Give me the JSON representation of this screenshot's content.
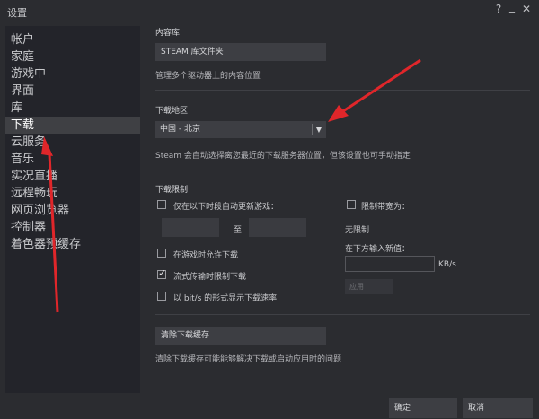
{
  "window": {
    "title": "设置",
    "help": "?",
    "minimize": "_",
    "close": "✕"
  },
  "sidebar": {
    "items": [
      {
        "label": "帐户"
      },
      {
        "label": "家庭"
      },
      {
        "label": "游戏中"
      },
      {
        "label": "界面"
      },
      {
        "label": "库"
      },
      {
        "label": "下载"
      },
      {
        "label": "云服务"
      },
      {
        "label": "音乐"
      },
      {
        "label": "实况直播"
      },
      {
        "label": "远程畅玩"
      },
      {
        "label": "网页浏览器"
      },
      {
        "label": "控制器"
      },
      {
        "label": "着色器预缓存"
      }
    ],
    "active_index": 5
  },
  "content_library": {
    "heading": "内容库",
    "button": "STEAM 库文件夹",
    "description": "管理多个驱动器上的内容位置"
  },
  "download_region": {
    "heading": "下载地区",
    "selected": "中国 - 北京",
    "description": "Steam 会自动选择离您最近的下载服务器位置，但该设置也可手动指定"
  },
  "download_limits": {
    "heading": "下载限制",
    "schedule_label": "仅在以下时段自动更新游戏：",
    "to_label": "至",
    "allow_in_game_label": "在游戏时允许下载",
    "throttle_streaming_label": "流式传输时限制下载",
    "bits_label": "以 bit/s 的形式显示下载速率",
    "bandwidth_label": "限制带宽为：",
    "no_limit": "无限制",
    "new_value_label": "在下方输入新值：",
    "unit": "KB/s",
    "apply": "应用",
    "schedule_checked": false,
    "allow_in_game_checked": false,
    "throttle_streaming_checked": true,
    "bits_checked": false,
    "bandwidth_checked": false
  },
  "clear_cache": {
    "button": "清除下载缓存",
    "description": "清除下载缓存可能能够解决下载或启动应用时的问题"
  },
  "footer": {
    "ok": "确定",
    "cancel": "取消"
  },
  "annotation_color": "#e0262a"
}
